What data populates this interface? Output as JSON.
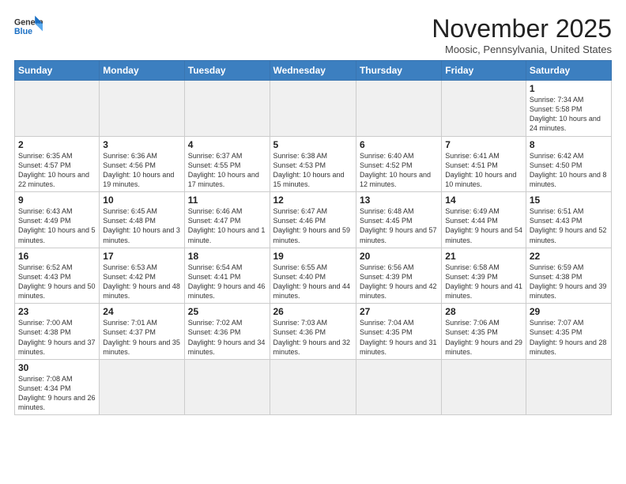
{
  "header": {
    "logo_general": "General",
    "logo_blue": "Blue",
    "month_title": "November 2025",
    "location": "Moosic, Pennsylvania, United States"
  },
  "days_of_week": [
    "Sunday",
    "Monday",
    "Tuesday",
    "Wednesday",
    "Thursday",
    "Friday",
    "Saturday"
  ],
  "weeks": [
    [
      {
        "day": "",
        "info": "",
        "empty": true
      },
      {
        "day": "",
        "info": "",
        "empty": true
      },
      {
        "day": "",
        "info": "",
        "empty": true
      },
      {
        "day": "",
        "info": "",
        "empty": true
      },
      {
        "day": "",
        "info": "",
        "empty": true
      },
      {
        "day": "",
        "info": "",
        "empty": true
      },
      {
        "day": "1",
        "info": "Sunrise: 7:34 AM\nSunset: 5:58 PM\nDaylight: 10 hours and 24 minutes."
      }
    ],
    [
      {
        "day": "2",
        "info": "Sunrise: 6:35 AM\nSunset: 4:57 PM\nDaylight: 10 hours and 22 minutes."
      },
      {
        "day": "3",
        "info": "Sunrise: 6:36 AM\nSunset: 4:56 PM\nDaylight: 10 hours and 19 minutes."
      },
      {
        "day": "4",
        "info": "Sunrise: 6:37 AM\nSunset: 4:55 PM\nDaylight: 10 hours and 17 minutes."
      },
      {
        "day": "5",
        "info": "Sunrise: 6:38 AM\nSunset: 4:53 PM\nDaylight: 10 hours and 15 minutes."
      },
      {
        "day": "6",
        "info": "Sunrise: 6:40 AM\nSunset: 4:52 PM\nDaylight: 10 hours and 12 minutes."
      },
      {
        "day": "7",
        "info": "Sunrise: 6:41 AM\nSunset: 4:51 PM\nDaylight: 10 hours and 10 minutes."
      },
      {
        "day": "8",
        "info": "Sunrise: 6:42 AM\nSunset: 4:50 PM\nDaylight: 10 hours and 8 minutes."
      }
    ],
    [
      {
        "day": "9",
        "info": "Sunrise: 6:43 AM\nSunset: 4:49 PM\nDaylight: 10 hours and 5 minutes."
      },
      {
        "day": "10",
        "info": "Sunrise: 6:45 AM\nSunset: 4:48 PM\nDaylight: 10 hours and 3 minutes."
      },
      {
        "day": "11",
        "info": "Sunrise: 6:46 AM\nSunset: 4:47 PM\nDaylight: 10 hours and 1 minute."
      },
      {
        "day": "12",
        "info": "Sunrise: 6:47 AM\nSunset: 4:46 PM\nDaylight: 9 hours and 59 minutes."
      },
      {
        "day": "13",
        "info": "Sunrise: 6:48 AM\nSunset: 4:45 PM\nDaylight: 9 hours and 57 minutes."
      },
      {
        "day": "14",
        "info": "Sunrise: 6:49 AM\nSunset: 4:44 PM\nDaylight: 9 hours and 54 minutes."
      },
      {
        "day": "15",
        "info": "Sunrise: 6:51 AM\nSunset: 4:43 PM\nDaylight: 9 hours and 52 minutes."
      }
    ],
    [
      {
        "day": "16",
        "info": "Sunrise: 6:52 AM\nSunset: 4:43 PM\nDaylight: 9 hours and 50 minutes."
      },
      {
        "day": "17",
        "info": "Sunrise: 6:53 AM\nSunset: 4:42 PM\nDaylight: 9 hours and 48 minutes."
      },
      {
        "day": "18",
        "info": "Sunrise: 6:54 AM\nSunset: 4:41 PM\nDaylight: 9 hours and 46 minutes."
      },
      {
        "day": "19",
        "info": "Sunrise: 6:55 AM\nSunset: 4:40 PM\nDaylight: 9 hours and 44 minutes."
      },
      {
        "day": "20",
        "info": "Sunrise: 6:56 AM\nSunset: 4:39 PM\nDaylight: 9 hours and 42 minutes."
      },
      {
        "day": "21",
        "info": "Sunrise: 6:58 AM\nSunset: 4:39 PM\nDaylight: 9 hours and 41 minutes."
      },
      {
        "day": "22",
        "info": "Sunrise: 6:59 AM\nSunset: 4:38 PM\nDaylight: 9 hours and 39 minutes."
      }
    ],
    [
      {
        "day": "23",
        "info": "Sunrise: 7:00 AM\nSunset: 4:38 PM\nDaylight: 9 hours and 37 minutes."
      },
      {
        "day": "24",
        "info": "Sunrise: 7:01 AM\nSunset: 4:37 PM\nDaylight: 9 hours and 35 minutes."
      },
      {
        "day": "25",
        "info": "Sunrise: 7:02 AM\nSunset: 4:36 PM\nDaylight: 9 hours and 34 minutes."
      },
      {
        "day": "26",
        "info": "Sunrise: 7:03 AM\nSunset: 4:36 PM\nDaylight: 9 hours and 32 minutes."
      },
      {
        "day": "27",
        "info": "Sunrise: 7:04 AM\nSunset: 4:35 PM\nDaylight: 9 hours and 31 minutes."
      },
      {
        "day": "28",
        "info": "Sunrise: 7:06 AM\nSunset: 4:35 PM\nDaylight: 9 hours and 29 minutes."
      },
      {
        "day": "29",
        "info": "Sunrise: 7:07 AM\nSunset: 4:35 PM\nDaylight: 9 hours and 28 minutes."
      }
    ],
    [
      {
        "day": "30",
        "info": "Sunrise: 7:08 AM\nSunset: 4:34 PM\nDaylight: 9 hours and 26 minutes."
      },
      {
        "day": "",
        "info": "",
        "empty": true
      },
      {
        "day": "",
        "info": "",
        "empty": true
      },
      {
        "day": "",
        "info": "",
        "empty": true
      },
      {
        "day": "",
        "info": "",
        "empty": true
      },
      {
        "day": "",
        "info": "",
        "empty": true
      },
      {
        "day": "",
        "info": "",
        "empty": true
      }
    ]
  ]
}
